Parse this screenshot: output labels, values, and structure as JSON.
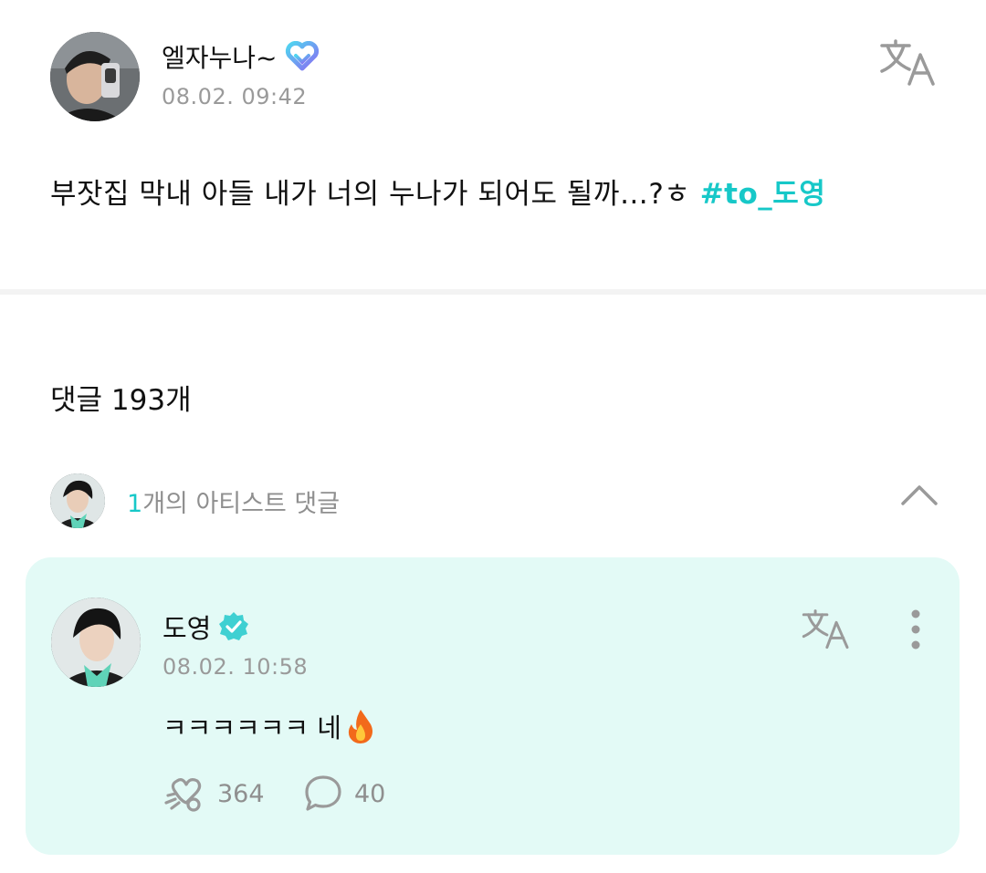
{
  "post": {
    "author": "엘자누나~",
    "timestamp": "08.02. 09:42",
    "text": "부잣집 막내 아들 내가 너의 누나가 되어도 될까…?ㅎ",
    "hashtag": "#to_도영",
    "fan_badge_icon": "heart-badge-icon",
    "translate_icon": "translate-icon"
  },
  "comments": {
    "header": "댓글 193개",
    "artist_summary": {
      "count": "1",
      "label": "개의 아티스트 댓글",
      "toggle_icon": "chevron-up-icon"
    },
    "artist_comment": {
      "name": "도영",
      "verified_icon": "verified-check-icon",
      "timestamp": "08.02. 10:58",
      "text": "ㅋㅋㅋㅋㅋㅋ 네",
      "emoji_icon": "fire-icon",
      "likes": "364",
      "replies": "40",
      "like_icon": "like-icon",
      "reply_icon": "comment-bubble-icon",
      "more_icon": "more-vertical-icon"
    }
  },
  "colors": {
    "accent": "#17c8c8",
    "card_background": "#e3faf6",
    "secondary_text": "#9a9a9a",
    "divider": "#f3f3f3"
  }
}
